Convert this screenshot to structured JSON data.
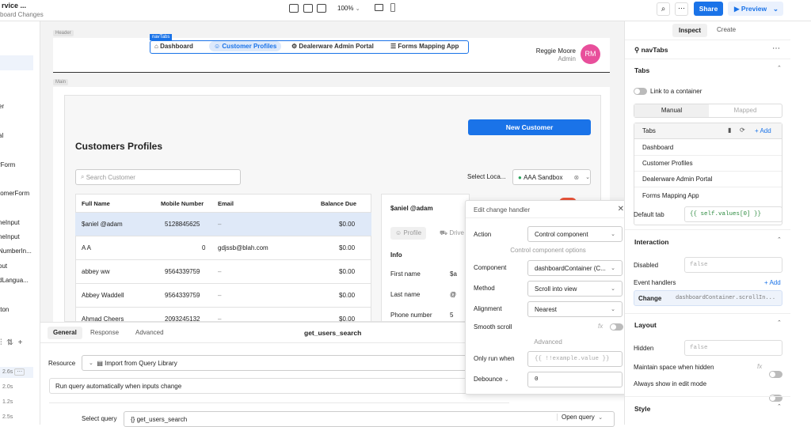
{
  "header": {
    "title": "rvice ...",
    "subtitle": "board Changes",
    "zoom": "100%",
    "share": "Share",
    "preview": "Preview"
  },
  "sidebar": {
    "items": [
      "er",
      "al",
      "rForm",
      "tomerForm",
      "neInput",
      "neInput",
      "NumberIn...",
      "out",
      "dLangua...",
      "tton"
    ],
    "timings": [
      "2.6s",
      "2.0s",
      "1.2s",
      "2.5s"
    ]
  },
  "canvas": {
    "header_tag": "Header",
    "main_tag": "Main",
    "navtabs_tag": "navTabs",
    "nav": [
      "Dashboard",
      "Customer Profiles",
      "Dealerware Admin Portal",
      "Forms Mapping App"
    ],
    "user_name": "Reggie Moore",
    "user_role": "Admin",
    "avatar": "RM",
    "new_customer": "New Customer",
    "page_title": "Customers Profiles",
    "search_placeholder": "Search Customer",
    "select_location": "Select Loca...",
    "location_value": "AAA Sandbox",
    "table_headers": [
      "Full Name",
      "Mobile Number",
      "Email",
      "Balance Due"
    ],
    "rows": [
      [
        "$aniel @adam",
        "5128845625",
        "–",
        "$0.00"
      ],
      [
        "A A",
        "0",
        "gdjssb@blah.com",
        "$0.00"
      ],
      [
        "abbey ww",
        "9564339759",
        "–",
        "$0.00"
      ],
      [
        "Abbey Waddell",
        "9564339759",
        "–",
        "$0.00"
      ],
      [
        "Ahmad Cheers",
        "2093245132",
        "–",
        "$0.00"
      ]
    ],
    "detail_name": "$aniel @adam",
    "detail_tabs": [
      "Profile",
      "Drive"
    ],
    "info": "Info",
    "info_fields": [
      {
        "label": "First name",
        "value": "$a"
      },
      {
        "label": "Last name",
        "value": "@"
      },
      {
        "label": "Phone number",
        "value": "5"
      }
    ]
  },
  "popover": {
    "title": "Edit change handler",
    "action_label": "Action",
    "action_value": "Control component",
    "options_divider": "Control component options",
    "component_label": "Component",
    "component_value": "dashboardContainer (C...",
    "method_label": "Method",
    "method_value": "Scroll into view",
    "alignment_label": "Alignment",
    "alignment_value": "Nearest",
    "smooth_label": "Smooth scroll",
    "advanced_divider": "Advanced",
    "only_run_label": "Only run when",
    "only_run_placeholder": "{{ !!example.value }}",
    "debounce_label": "Debounce",
    "debounce_value": "0"
  },
  "right": {
    "tabs": [
      "Inspect",
      "Create"
    ],
    "component": "navTabs",
    "tabs_section": "Tabs",
    "link_container": "Link to a container",
    "manual": "Manual",
    "mapped": "Mapped",
    "tabs_label": "Tabs",
    "add": "+ Add",
    "tab_items": [
      "Dashboard",
      "Customer Profiles",
      "Dealerware Admin Portal",
      "Forms Mapping App"
    ],
    "default_tab_label": "Default tab",
    "default_tab_value": "{{ self.values[0] }}",
    "interaction": "Interaction",
    "disabled_label": "Disabled",
    "disabled_value": "false",
    "event_handlers": "Event handlers",
    "add2": "+ Add",
    "event_name": "Change",
    "event_value": "dashboardContainer.scrollIn...",
    "layout": "Layout",
    "hidden_label": "Hidden",
    "hidden_value": "false",
    "maintain": "Maintain space when hidden",
    "always_show": "Always show in edit mode",
    "style": "Style"
  },
  "bottom": {
    "tabs": [
      "General",
      "Response",
      "Advanced"
    ],
    "query_name": "get_users_search",
    "resource_label": "Resource",
    "resource_value": "Import from Query Library",
    "run_auto": "Run query automatically when inputs change",
    "select_query_label": "Select query",
    "select_query_value": "get_users_search",
    "open_query": "Open query"
  }
}
